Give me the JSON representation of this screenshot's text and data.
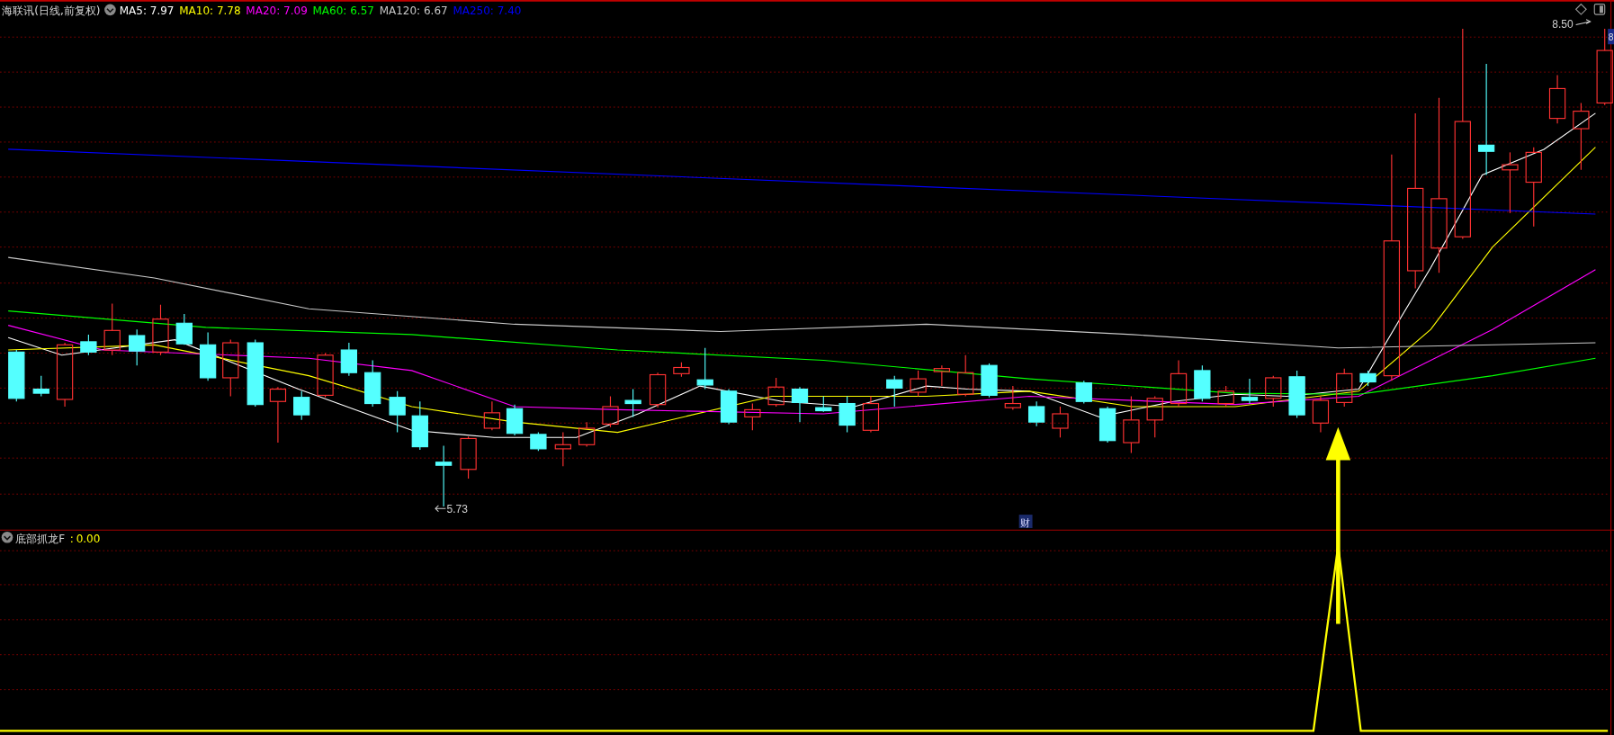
{
  "chart_header": {
    "title": "海联讯(日线,前复权)",
    "moving_averages": [
      {
        "text": "MA5: 7.97",
        "color": "#ffffff"
      },
      {
        "text": "MA10: 7.78",
        "color": "#ffff00"
      },
      {
        "text": "MA20: 7.09",
        "color": "#ff00ff"
      },
      {
        "text": "MA60: 6.57",
        "color": "#00ff00"
      },
      {
        "text": "MA120: 6.67",
        "color": "#c8c8c8"
      },
      {
        "text": "MA250: 7.40",
        "color": "#0000ff"
      }
    ]
  },
  "price_chart": {
    "high_label": "8.50",
    "low_label": "5.73",
    "event_marker": "财",
    "edge_tab": "8"
  },
  "indicator_panel": {
    "name": "底部抓龙F",
    "separator": ":",
    "value": "0.00"
  }
}
